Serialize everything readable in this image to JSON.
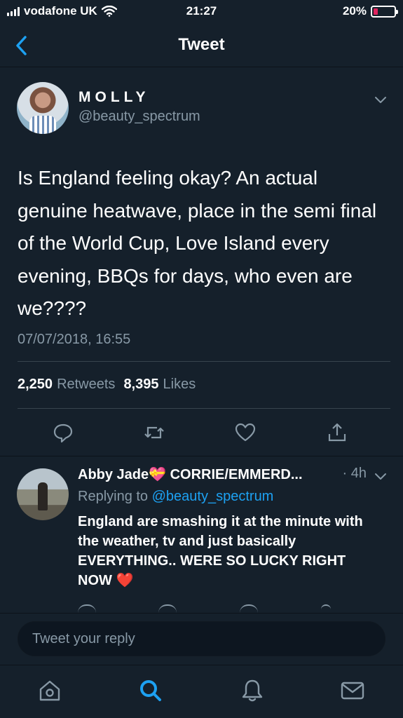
{
  "status_bar": {
    "carrier": "vodafone UK",
    "time": "21:27",
    "battery": "20%",
    "battery_level": 0.2,
    "battery_color": "#e0245e"
  },
  "nav": {
    "title": "Tweet",
    "back_icon": "chevron-left-icon"
  },
  "tweet": {
    "display_name": "MOLLY",
    "handle": "@beauty_spectrum",
    "text": "Is England feeling okay? An actual genuine heatwave, place in the semi final of the World Cup, Love Island every evening, BBQs for days, who even are we????",
    "timestamp": "07/07/2018, 16:55",
    "retweets_count": "2,250",
    "retweets_label": "Retweets",
    "likes_count": "8,395",
    "likes_label": "Likes",
    "actions": [
      "reply-icon",
      "retweet-icon",
      "heart-icon",
      "share-icon"
    ]
  },
  "reply": {
    "name": "Abby Jade💝 CORRIE/EMMERD...",
    "time": "· 4h",
    "replying_prefix": "Replying to",
    "replying_to": "@beauty_spectrum",
    "text": "England are smashing it at the minute with the weather, tv and just basically EVERYTHING.. WERE SO LUCKY RIGHT NOW",
    "emoji": "❤️"
  },
  "composer": {
    "placeholder": "Tweet your reply"
  },
  "tabbar": {
    "tabs": [
      "home-icon",
      "search-icon",
      "notifications-icon",
      "messages-icon"
    ],
    "active": "search-icon"
  },
  "colors": {
    "background": "#15202b",
    "accent": "#1da1f2",
    "muted": "#8899a6",
    "divider": "#38444d"
  }
}
